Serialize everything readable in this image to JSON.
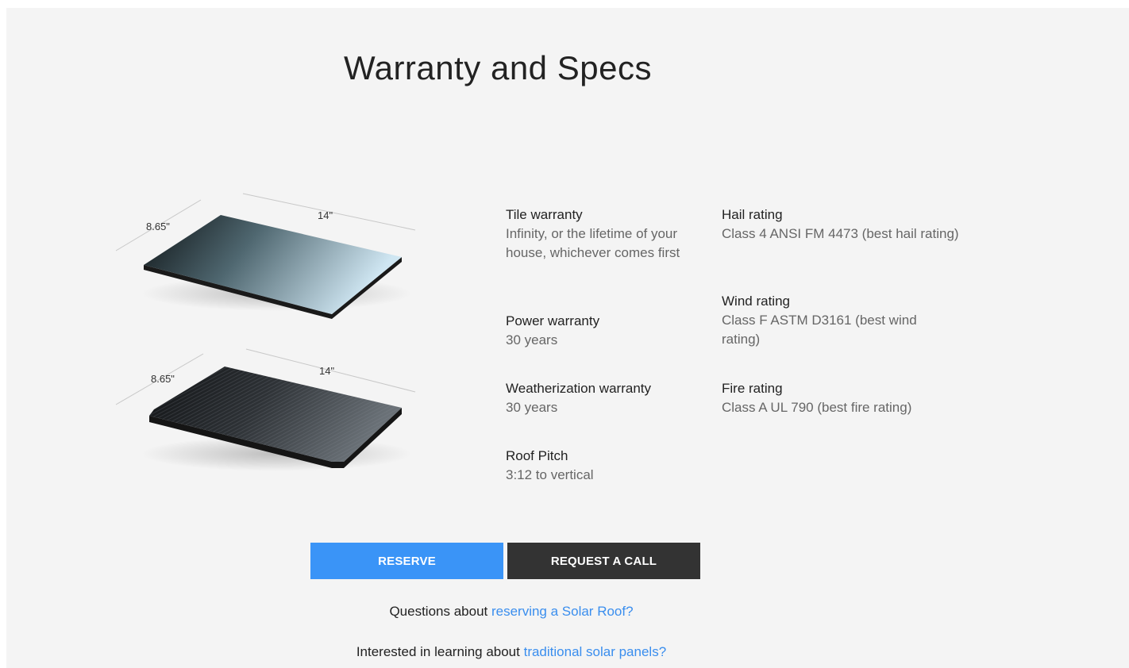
{
  "section": {
    "title": "Warranty and Specs"
  },
  "illustrations": {
    "smooth_tile": {
      "length_label": "14\"",
      "width_label": "8.65\""
    },
    "textured_tile": {
      "length_label": "14\"",
      "width_label": "8.65\""
    }
  },
  "specs": {
    "tile_warranty": {
      "label": "Tile warranty",
      "value": "Infinity, or the lifetime of your house, whichever comes first"
    },
    "power_warranty": {
      "label": "Power warranty",
      "value": "30 years"
    },
    "weatherization_warranty": {
      "label": "Weatherization warranty",
      "value": "30 years"
    },
    "roof_pitch": {
      "label": "Roof Pitch",
      "value": "3:12 to vertical"
    },
    "hail_rating": {
      "label": "Hail rating",
      "value": "Class 4 ANSI FM 4473 (best hail rating)"
    },
    "wind_rating": {
      "label": "Wind rating",
      "value": "Class F ASTM D3161 (best wind rating)"
    },
    "fire_rating": {
      "label": "Fire rating",
      "value": "Class A UL 790 (best fire rating)"
    }
  },
  "buttons": {
    "reserve": "RESERVE",
    "request_call": "REQUEST A CALL"
  },
  "links": {
    "q1_prefix": "Questions about ",
    "q1_link": "reserving a Solar Roof?",
    "q2_prefix": "Interested in learning about ",
    "q2_link": "traditional solar panels?"
  },
  "colors": {
    "accent": "#3a94f7",
    "dark_button": "#333333",
    "link": "#3a8eee"
  }
}
